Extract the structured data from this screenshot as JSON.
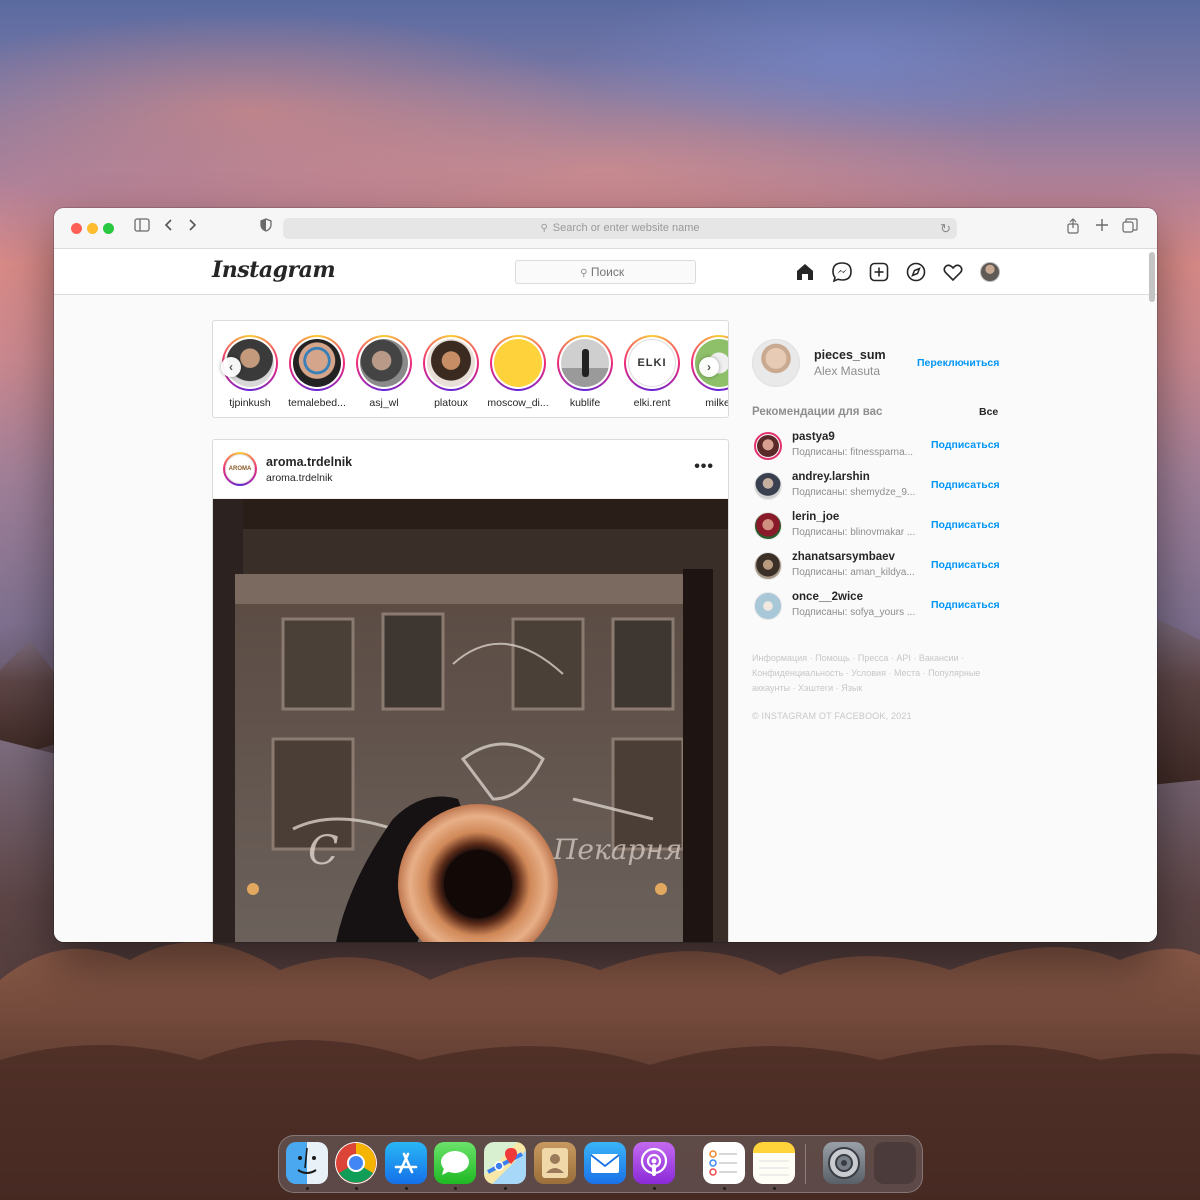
{
  "browser": {
    "address_placeholder": "Search or enter website name"
  },
  "instagram": {
    "logo": "Instagram",
    "search_placeholder": "Поиск",
    "stories": [
      {
        "name": "tjpinkush"
      },
      {
        "name": "temalebed..."
      },
      {
        "name": "asj_wl"
      },
      {
        "name": "platoux"
      },
      {
        "name": "moscow_di..."
      },
      {
        "name": "kublife"
      },
      {
        "name": "elki.rent"
      },
      {
        "name": "milkef"
      }
    ],
    "post": {
      "username": "aroma.trdelnik",
      "location": "aroma.trdelnik",
      "avatar_text": "AROMA"
    },
    "sidebar": {
      "username": "pieces_sum",
      "full_name": "Alex Masuta",
      "switch_label": "Переключиться",
      "recommendations_title": "Рекомендации для вас",
      "see_all": "Все",
      "suggestions": [
        {
          "username": "pastya9",
          "subtitle": "Подписаны: fitnessparna...",
          "follow": "Подписаться"
        },
        {
          "username": "andrey.larshin",
          "subtitle": "Подписаны: shemydze_9...",
          "follow": "Подписаться"
        },
        {
          "username": "lerin_joe",
          "subtitle": "Подписаны: blinovmakar ...",
          "follow": "Подписаться"
        },
        {
          "username": "zhanatsarsymbaev",
          "subtitle": "Подписаны: aman_kildya...",
          "follow": "Подписаться"
        },
        {
          "username": "once__2wice",
          "subtitle": "Подписаны: sofya_yours ...",
          "follow": "Подписаться"
        }
      ],
      "footer_links": "Информация · Помощь · Пресса · API · Вакансии · Конфиденциальность · Условия · Места · Популярные аккаунты · Хэштеги · Язык",
      "copyright": "© INSTAGRAM ОТ FACEBOOK, 2021"
    }
  },
  "colors": {
    "accent": "#0095f6",
    "story_ring": "#e1306c"
  },
  "dock": {
    "apps": [
      "finder-icon",
      "chrome-icon",
      "app-store-icon",
      "messages-icon",
      "maps-icon",
      "contacts-icon",
      "mail-icon",
      "podcasts-icon",
      "reminders-icon",
      "notes-icon",
      "system-preferences-icon",
      "empty-slot"
    ]
  }
}
